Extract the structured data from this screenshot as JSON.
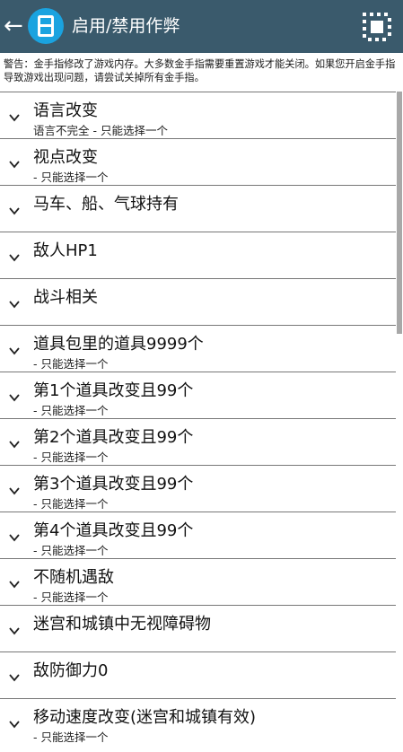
{
  "appbar": {
    "title": "启用/禁用作弊"
  },
  "warning": "警告：金手指修改了游戏内存。大多数金手指需要重置游戏才能关闭。如果您开启金手指导致游戏出现问题，请尝试关掉所有金手指。",
  "items": [
    {
      "name": "语言改变",
      "sub": "语言不完全 - 只能选择一个"
    },
    {
      "name": "视点改变",
      "sub": " - 只能选择一个"
    },
    {
      "name": "马车、船、气球持有",
      "sub": ""
    },
    {
      "name": "敌人HP1",
      "sub": ""
    },
    {
      "name": "战斗相关",
      "sub": ""
    },
    {
      "name": "道具包里的道具9999个",
      "sub": " - 只能选择一个"
    },
    {
      "name": "第1个道具改变且99个",
      "sub": " - 只能选择一个"
    },
    {
      "name": "第2个道具改变且99个",
      "sub": " - 只能选择一个"
    },
    {
      "name": "第3个道具改变且99个",
      "sub": " - 只能选择一个"
    },
    {
      "name": "第4个道具改变且99个",
      "sub": " - 只能选择一个"
    },
    {
      "name": "不随机遇敌",
      "sub": " - 只能选择一个"
    },
    {
      "name": "迷宫和城镇中无视障碍物",
      "sub": ""
    },
    {
      "name": "敌防御力0",
      "sub": ""
    },
    {
      "name": "移动速度改变(迷宫和城镇有效)",
      "sub": " - 只能选择一个"
    }
  ]
}
